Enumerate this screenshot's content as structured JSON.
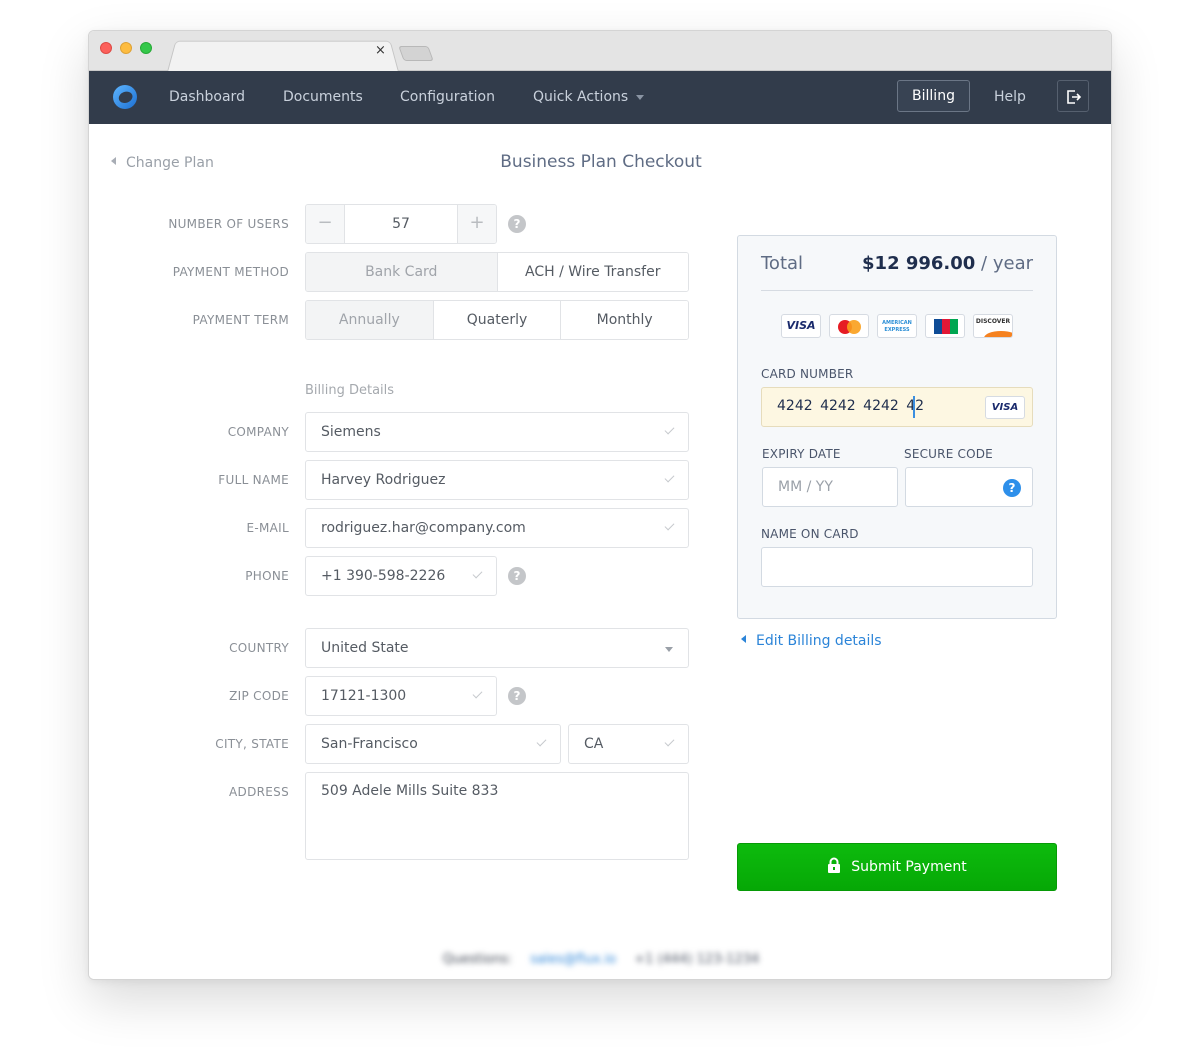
{
  "browser": {
    "tab_close_glyph": "×"
  },
  "navbar": {
    "items": [
      {
        "label": "Dashboard"
      },
      {
        "label": "Documents"
      },
      {
        "label": "Configuration"
      },
      {
        "label": "Quick Actions"
      }
    ],
    "billing_label": "Billing",
    "help_label": "Help"
  },
  "page": {
    "back_label": "Change Plan",
    "title": "Business Plan Checkout"
  },
  "form": {
    "users_label": "NUMBER OF USERS",
    "users_value": "57",
    "minus": "−",
    "plus": "+",
    "help_glyph": "?",
    "payment_method_label": "PAYMENT METHOD",
    "payment_methods": [
      {
        "label": "Bank Card",
        "active": true
      },
      {
        "label": "ACH / Wire Transfer",
        "active": false
      }
    ],
    "payment_term_label": "PAYMENT TERM",
    "payment_terms": [
      {
        "label": "Annually",
        "active": true
      },
      {
        "label": "Quaterly",
        "active": false
      },
      {
        "label": "Monthly",
        "active": false
      }
    ],
    "billing_section": "Billing Details",
    "company_label": "COMPANY",
    "company_value": "Siemens",
    "fullname_label": "FULL NAME",
    "fullname_value": "Harvey Rodriguez",
    "email_label": "E-MAIL",
    "email_value": "rodriguez.har@company.com",
    "phone_label": "PHONE",
    "phone_value": "+1 390-598-2226",
    "country_label": "COUNTRY",
    "country_value": "United State",
    "zip_label": "ZIP CODE",
    "zip_value": "17121-1300",
    "city_state_label": "CITY, STATE",
    "city_value": "San-Francisco",
    "state_value": "CA",
    "address_label": "ADDRESS",
    "address_value": "509 Adele Mills Suite 833"
  },
  "payment": {
    "total_label": "Total",
    "total_amount": "$12 996.00",
    "total_period": " / year",
    "card_brands": [
      "VISA",
      "MasterCard",
      "AMERICAN EXPRESS",
      "JCB",
      "DISCOVER"
    ],
    "card_number_label": "CARD NUMBER",
    "card_number_value": "4242  4242  4242 42",
    "card_number_brand": "VISA",
    "expiry_label": "EXPIRY DATE",
    "expiry_placeholder": "MM  /  YY",
    "secure_label": "SECURE CODE",
    "secure_help": "?",
    "name_label": "NAME ON CARD",
    "name_value": "",
    "edit_link": "Edit Billing details",
    "submit_label": "Submit Payment"
  },
  "footer": {
    "questions": "Questions:",
    "email": "sales@flux.io",
    "phone": "+1 (444) 123-1234"
  }
}
